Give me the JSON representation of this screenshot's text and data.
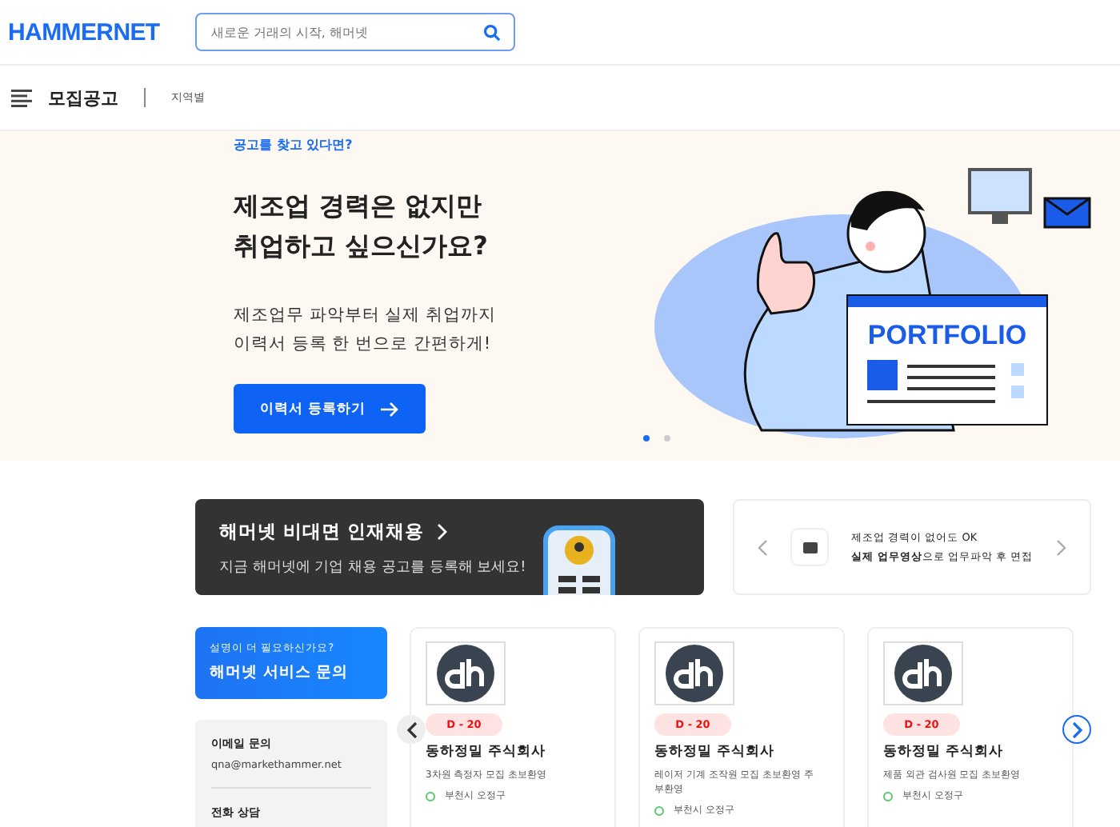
{
  "header": {
    "logo": "HAMMERNET",
    "search": {
      "placeholder": "새로운 거래의 시작, 해머넷"
    }
  },
  "nav": {
    "title": "모집공고",
    "items": [
      "지역별"
    ]
  },
  "hero": {
    "eyebrow": "공고를 찾고 있다면?",
    "headline": [
      "제조업 경력은 없지만",
      "취업하고 싶으신가요?"
    ],
    "body": [
      "제조업무 파악부터 실제 취업까지",
      "이력서 등록 한 번으로 간편하게!"
    ],
    "button": "이력서 등록하기",
    "illustration_text": "PORTFOLIO",
    "dots": [
      {
        "selected": true
      },
      {
        "selected": false
      }
    ]
  },
  "banner": {
    "title": "해머넷 비대면 인재채용",
    "subtitle": "지금 해머넷에 기업 채용 공고를 등록해 보세요!"
  },
  "promo": {
    "line1": "제조업 경력이 없어도 OK",
    "line2": "**실제 업무영상**으로 업무파악 후 면접"
  },
  "inquiry": {
    "eyebrow": "설명이 더 필요하신가요?",
    "title": "해머넷 서비스 문의"
  },
  "contact": [
    {
      "label": "이메일 문의",
      "value": "qna@markethammer.net"
    },
    {
      "label": "전화 상담"
    }
  ],
  "jobs": [
    {
      "dday": "D - 20",
      "company": "동하정밀 주식회사",
      "desc": "3차원 측정자 모집 초보환영",
      "location": "부천시 오정구"
    },
    {
      "dday": "D - 20",
      "company": "동하정밀 주식회사",
      "desc": "레이저 기계 조작원 모집 초보환영 주부환영",
      "location": "부천시 오정구"
    },
    {
      "dday": "D - 20",
      "company": "동하정밀 주식회사",
      "desc": "제품 외관 검사원 모집 초보환영",
      "location": "부천시 오정구"
    }
  ]
}
